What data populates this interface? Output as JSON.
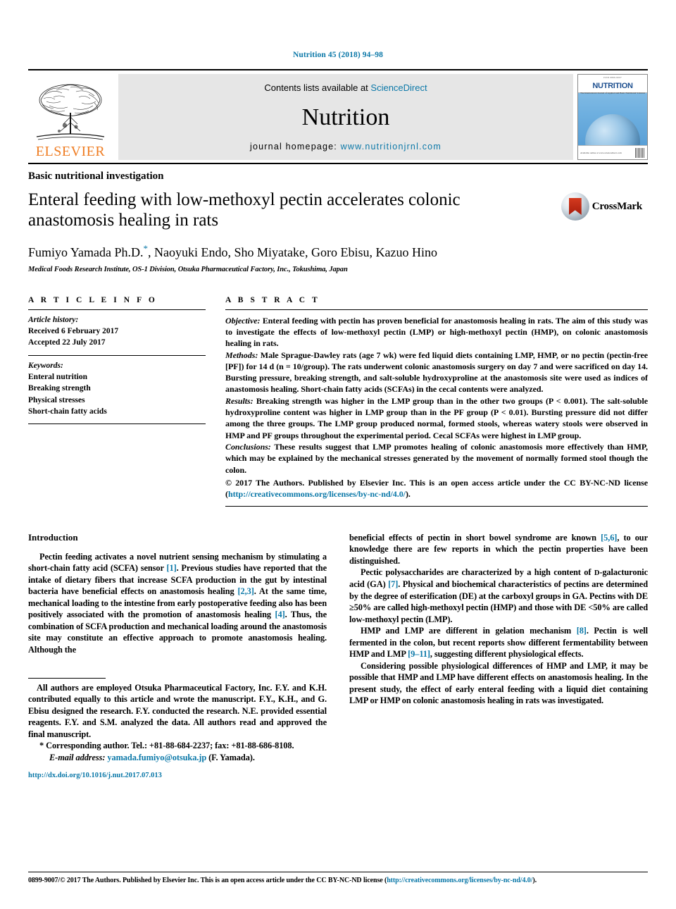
{
  "running_head": "Nutrition 45 (2018) 94–98",
  "masthead": {
    "contents_prefix": "Contents lists available at ",
    "contents_link": "ScienceDirect",
    "journal_name": "Nutrition",
    "homepage_prefix": "journal homepage: ",
    "homepage_link": "www.nutritionjrnl.com",
    "publisher": "ELSEVIER",
    "cover": {
      "top_tiny": "ISSN 0899-9007",
      "title": "NUTRITION",
      "subtitle": "The International Journal of Applied and Basic Nutritional Sciences",
      "bottom_text": "Available online at www.sciencedirect.com"
    }
  },
  "article": {
    "kind": "Basic nutritional investigation",
    "title": "Enteral feeding with low-methoxyl pectin accelerates colonic anastomosis healing in rats",
    "crossmark_label": "CrossMark",
    "authors": "Fumiyo Yamada Ph.D.",
    "authors_rest": ", Naoyuki Endo, Sho Miyatake, Goro Ebisu, Kazuo Hino",
    "affiliation": "Medical Foods Research Institute, OS-1 Division, Otsuka Pharmaceutical Factory, Inc., Tokushima, Japan"
  },
  "article_info": {
    "heading": "A R T I C L E  I N F O",
    "history_label": "Article history:",
    "received": "Received 6 February 2017",
    "accepted": "Accepted 22 July 2017",
    "keywords_label": "Keywords:",
    "keywords": [
      "Enteral nutrition",
      "Breaking strength",
      "Physical stresses",
      "Short-chain fatty acids"
    ]
  },
  "abstract": {
    "heading": "A B S T R A C T",
    "objective_label": "Objective:",
    "objective_text": " Enteral feeding with pectin has proven beneficial for anastomosis healing in rats. The aim of this study was to investigate the effects of low-methoxyl pectin (LMP) or high-methoxyl pectin (HMP), on colonic anastomosis healing in rats.",
    "methods_label": "Methods:",
    "methods_text": " Male Sprague-Dawley rats (age 7 wk) were fed liquid diets containing LMP, HMP, or no pectin (pectin-free [PF]) for 14 d (n = 10/group). The rats underwent colonic anastomosis surgery on day 7 and were sacrificed on day 14. Bursting pressure, breaking strength, and salt-soluble hydroxyproline at the anastomosis site were used as indices of anastomosis healing. Short-chain fatty acids (SCFAs) in the cecal contents were analyzed.",
    "results_label": "Results:",
    "results_text": " Breaking strength was higher in the LMP group than in the other two groups (P < 0.001). The salt-soluble hydroxyproline content was higher in LMP group than in the PF group (P < 0.01). Bursting pressure did not differ among the three groups. The LMP group produced normal, formed stools, whereas watery stools were observed in HMP and PF groups throughout the experimental period. Cecal SCFAs were highest in LMP group.",
    "conclusions_label": "Conclusions:",
    "conclusions_text": " These results suggest that LMP promotes healing of colonic anastomosis more effectively than HMP, which may be explained by the mechanical stresses generated by the movement of normally formed stool though the colon.",
    "copyright_text": "© 2017 The Authors. Published by Elsevier Inc. This is an open access article under the CC BY-NC-ND license (",
    "copyright_link": "http://creativecommons.org/licenses/by-nc-nd/4.0/",
    "copyright_tail": ")."
  },
  "introduction": {
    "heading": "Introduction",
    "left_p1_a": "Pectin feeding activates a novel nutrient sensing mechanism by stimulating a short-chain fatty acid (SCFA) sensor ",
    "left_p1_ref1": "[1]",
    "left_p1_b": ". Previous studies have reported that the intake of dietary fibers that increase SCFA production in the gut by intestinal bacteria have beneficial effects on anastomosis healing ",
    "left_p1_ref2": "[2,3]",
    "left_p1_c": ". At the same time, mechanical loading to the intestine from early postoperative feeding also has been positively associated with the promotion of anastomosis healing ",
    "left_p1_ref3": "[4]",
    "left_p1_d": ". Thus, the combination of SCFA production and mechanical loading around the anastomosis site may constitute an effective approach to promote anastomosis healing. Although the",
    "right_p1_a": "beneficial effects of pectin in short bowel syndrome are known ",
    "right_p1_ref1": "[5,6]",
    "right_p1_b": ", to our knowledge there are few reports in which the pectin properties have been distinguished.",
    "right_p2_a": "Pectic polysaccharides are characterized by a high content of ",
    "right_p2_small": "D",
    "right_p2_b": "-galacturonic acid (GA) ",
    "right_p2_ref1": "[7]",
    "right_p2_c": ". Physical and biochemical characteristics of pectins are determined by the degree of esterification (DE) at the carboxyl groups in GA. Pectins with DE ≥50% are called high-methoxyl pectin (HMP) and those with DE <50% are called low-methoxyl pectin (LMP).",
    "right_p3_a": "HMP and LMP are different in gelation mechanism ",
    "right_p3_ref1": "[8]",
    "right_p3_b": ". Pectin is well fermented in the colon, but recent reports show different fermentability between HMP and LMP ",
    "right_p3_ref2": "[9–11]",
    "right_p3_c": ", suggesting different physiological effects.",
    "right_p4": "Considering possible physiological differences of HMP and LMP, it may be possible that HMP and LMP have different effects on anastomosis healing. In the present study, the effect of early enteral feeding with a liquid diet containing LMP or HMP on colonic anastomosis healing in rats was investigated."
  },
  "footnotes": {
    "contrib": "All authors are employed Otsuka Pharmaceutical Factory, Inc. F.Y. and K.H. contributed equally to this article and wrote the manuscript. F.Y., K.H., and G. Ebisu designed the research. F.Y. conducted the research. N.E. provided essential reagents. F.Y. and S.M. analyzed the data. All authors read and approved the final manuscript.",
    "corresponding": "* Corresponding author. Tel.: +81-88-684-2237; fax: +81-88-686-8108.",
    "email_label": "E-mail address:",
    "email": "yamada.fumiyo@otsuka.jp",
    "email_tail": " (F. Yamada).",
    "doi": "http://dx.doi.org/10.1016/j.nut.2017.07.013"
  },
  "page_footer": {
    "issn_text": "0899-9007/© 2017 The Authors. Published by Elsevier Inc. This is an open access article under the CC BY-NC-ND license (",
    "issn_link": "http://creativecommons.org/licenses/by-nc-nd/4.0/",
    "issn_tail": ")."
  },
  "colors": {
    "link": "#0b78a8",
    "elsevier_orange": "#ef7d23",
    "cover_blue": "#1d4f8f"
  }
}
